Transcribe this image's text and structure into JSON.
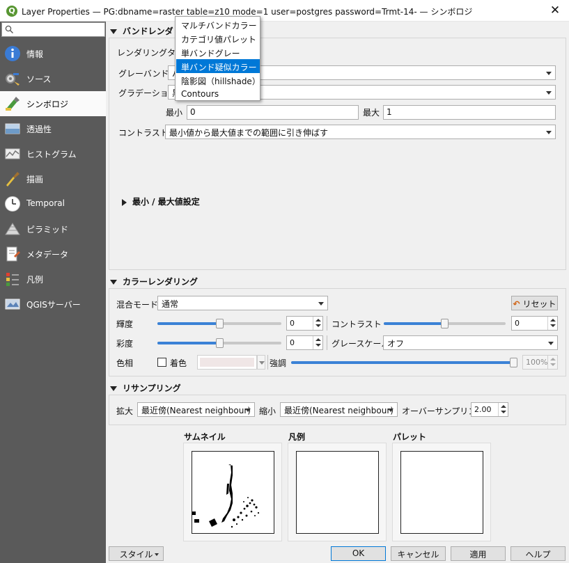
{
  "window": {
    "title": "Layer Properties — PG:dbname=raster table=z10 mode=1 user=postgres password=Trmt-14- — シンボロジ",
    "close_glyph": "✕"
  },
  "sidebar": {
    "search_placeholder": "",
    "items": [
      {
        "label": "情報",
        "icon": "info-icon"
      },
      {
        "label": "ソース",
        "icon": "source-icon"
      },
      {
        "label": "シンボロジ",
        "icon": "symbology-icon",
        "active": true
      },
      {
        "label": "透過性",
        "icon": "transparency-icon"
      },
      {
        "label": "ヒストグラム",
        "icon": "histogram-icon"
      },
      {
        "label": "描画",
        "icon": "rendering-icon"
      },
      {
        "label": "Temporal",
        "icon": "clock-icon"
      },
      {
        "label": "ピラミッド",
        "icon": "pyramids-icon"
      },
      {
        "label": "メタデータ",
        "icon": "metadata-icon"
      },
      {
        "label": "凡例",
        "icon": "legend-icon"
      },
      {
        "label": "QGISサーバー",
        "icon": "qgis-server-icon"
      }
    ]
  },
  "band_rendering": {
    "header": "バンドレンダリング",
    "render_type_label": "レンダリングタイプ",
    "render_type_options": [
      "マルチバンドカラー",
      "カテゴリ値パレット",
      "単バンドグレー",
      "単バンド疑似カラー",
      "陰影図（hillshade）",
      "Contours"
    ],
    "render_type_highlighted": "単バンド疑似カラー",
    "gray_band_label": "グレーバンド",
    "gray_band_value": "バ",
    "gradient_label": "グラデーション",
    "gradient_value": "黒",
    "min_label": "最小",
    "min_value": "0",
    "max_label": "最大",
    "max_value": "1",
    "contrast_label": "コントラスト",
    "contrast_value": "最小値から最大値までの範囲に引き伸ばす",
    "minmax_header": "最小 / 最大値設定"
  },
  "color_rendering": {
    "header": "カラーレンダリング",
    "blend_label": "混合モード",
    "blend_value": "通常",
    "reset_label": "リセット",
    "brightness_label": "輝度",
    "brightness_value": "0",
    "brightness_level": 0.5,
    "contrast_label": "コントラスト",
    "contrast_value": "0",
    "contrast_level": 0.5,
    "saturation_label": "彩度",
    "saturation_value": "0",
    "saturation_level": 0.5,
    "grayscale_label": "グレースケール",
    "grayscale_value": "オフ",
    "hue_label": "色相",
    "colorize_label": "着色",
    "colorize_checked": false,
    "colorize_color": "#f0e6e6",
    "strength_label": "強調",
    "strength_value": "100%",
    "strength_level": 1.0
  },
  "resampling": {
    "header": "リサンプリング",
    "zoomin_label": "拡大",
    "zoomin_value": "最近傍(Nearest neighbour)",
    "zoomout_label": "縮小",
    "zoomout_value": "最近傍(Nearest neighbour)",
    "oversampling_label": "オーバーサンプリング",
    "oversampling_value": "2.00"
  },
  "previews": {
    "thumbnail_label": "サムネイル",
    "legend_label": "凡例",
    "palette_label": "パレット"
  },
  "buttons": {
    "style_label": "スタイル",
    "ok_label": "OK",
    "cancel_label": "キャンセル",
    "apply_label": "適用",
    "help_label": "ヘルプ"
  },
  "colors": {
    "sidebar_bg": "#5a5a5a",
    "accent": "#0078d7",
    "slider_fill": "#3b82d6"
  }
}
